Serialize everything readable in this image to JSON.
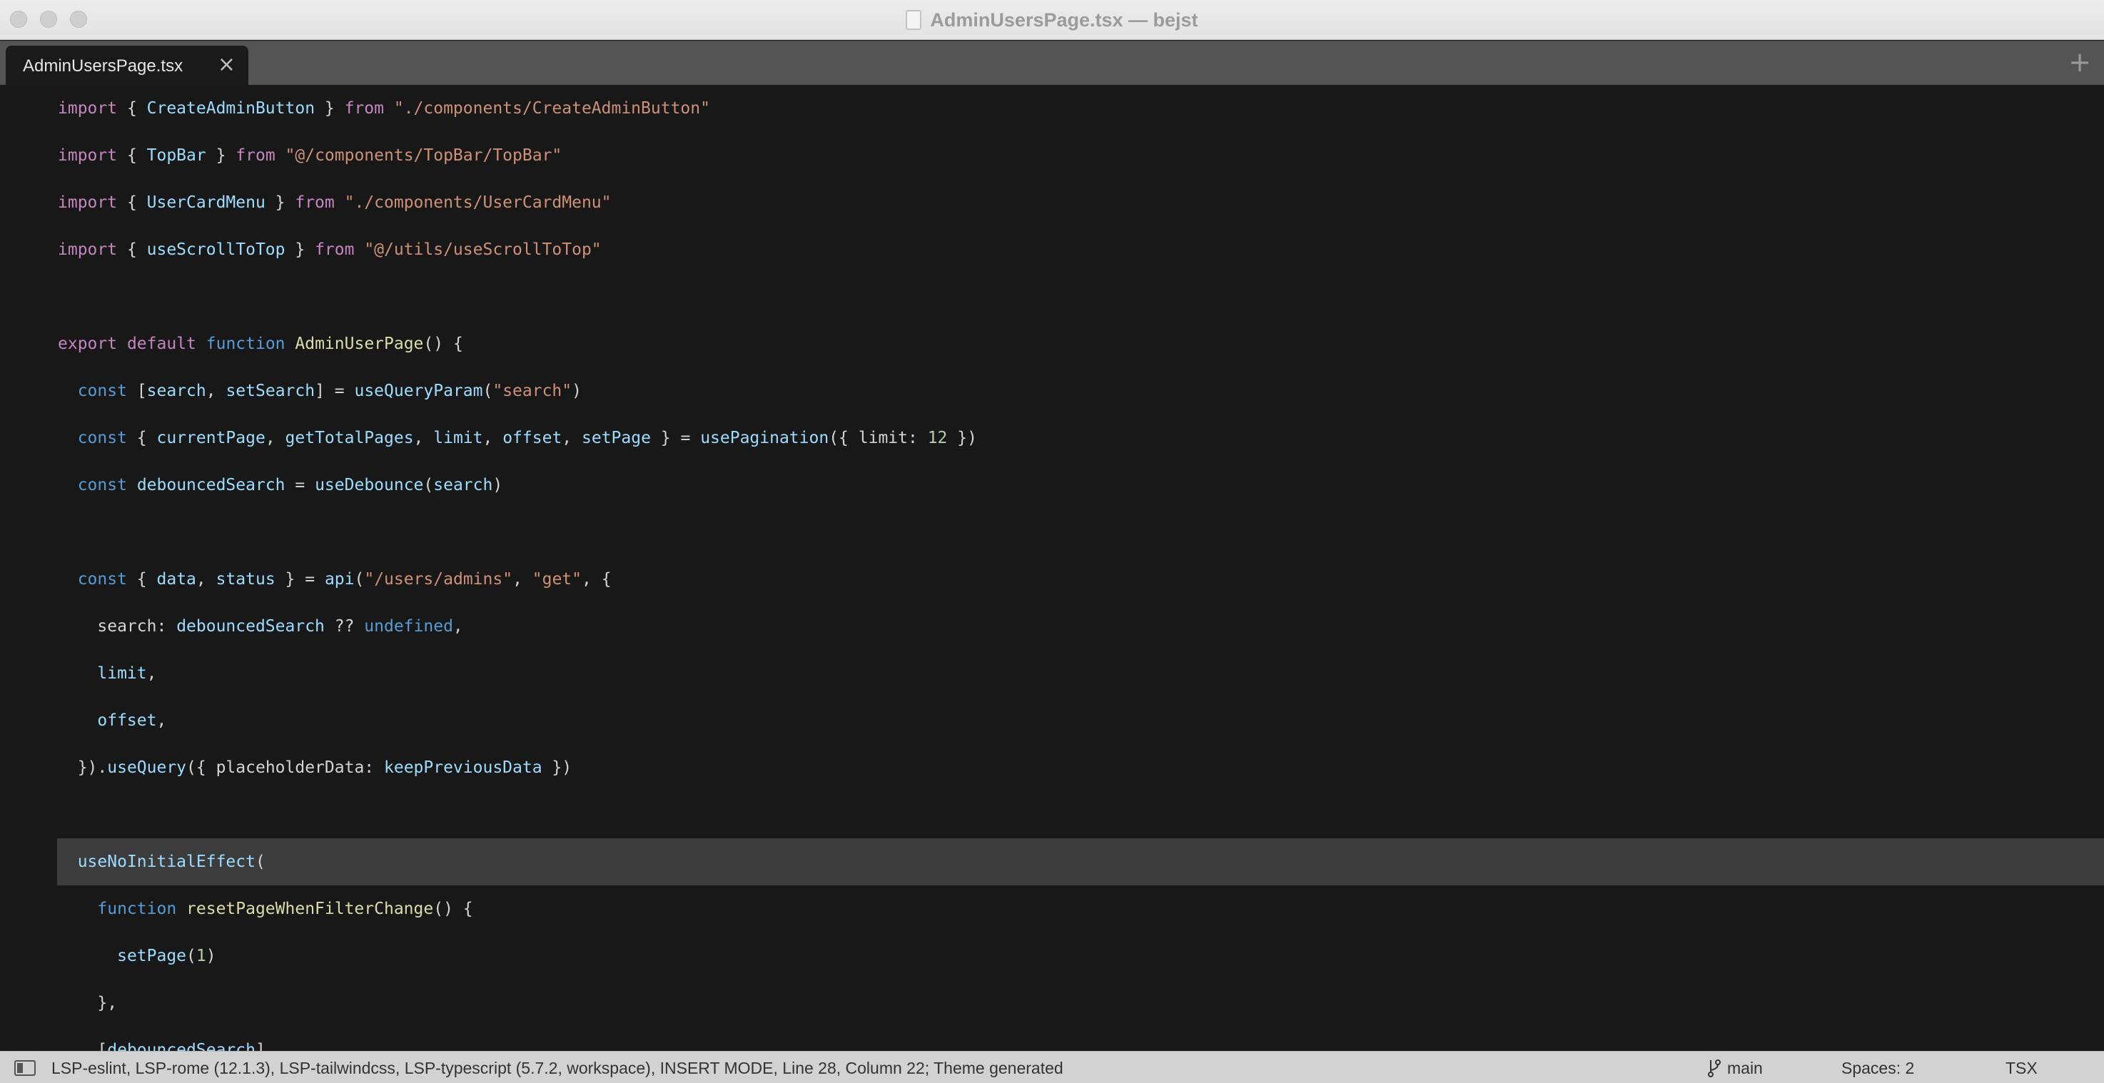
{
  "window": {
    "title": "AdminUsersPage.tsx — bejst",
    "traffic_lights": [
      "close",
      "minimize",
      "zoom"
    ]
  },
  "tabs": [
    {
      "label": "AdminUsersPage.tsx",
      "close_glyph": "×",
      "active": true
    }
  ],
  "tabbar": {
    "add_glyph": "+"
  },
  "editor": {
    "current_line_index": 16,
    "lines": [
      [
        [
          "t-kw",
          "import"
        ],
        [
          "t-pun",
          " { "
        ],
        [
          "t-id",
          "CreateAdminButton"
        ],
        [
          "t-pun",
          " } "
        ],
        [
          "t-kw",
          "from"
        ],
        [
          "t-pun",
          " "
        ],
        [
          "t-str",
          "\"./components/CreateAdminButton\""
        ]
      ],
      [
        [
          "t-kw",
          "import"
        ],
        [
          "t-pun",
          " { "
        ],
        [
          "t-id",
          "TopBar"
        ],
        [
          "t-pun",
          " } "
        ],
        [
          "t-kw",
          "from"
        ],
        [
          "t-pun",
          " "
        ],
        [
          "t-str",
          "\"@/components/TopBar/TopBar\""
        ]
      ],
      [
        [
          "t-kw",
          "import"
        ],
        [
          "t-pun",
          " { "
        ],
        [
          "t-id",
          "UserCardMenu"
        ],
        [
          "t-pun",
          " } "
        ],
        [
          "t-kw",
          "from"
        ],
        [
          "t-pun",
          " "
        ],
        [
          "t-str",
          "\"./components/UserCardMenu\""
        ]
      ],
      [
        [
          "t-kw",
          "import"
        ],
        [
          "t-pun",
          " { "
        ],
        [
          "t-id",
          "useScrollToTop"
        ],
        [
          "t-pun",
          " } "
        ],
        [
          "t-kw",
          "from"
        ],
        [
          "t-pun",
          " "
        ],
        [
          "t-str",
          "\"@/utils/useScrollToTop\""
        ]
      ],
      [],
      [
        [
          "t-kw",
          "export"
        ],
        [
          "t-pun",
          " "
        ],
        [
          "t-kw",
          "default"
        ],
        [
          "t-pun",
          " "
        ],
        [
          "t-kw2",
          "function"
        ],
        [
          "t-pun",
          " "
        ],
        [
          "t-fn",
          "AdminUserPage"
        ],
        [
          "t-pun",
          "() {"
        ]
      ],
      [
        [
          "t-pun",
          "  "
        ],
        [
          "t-kw2",
          "const"
        ],
        [
          "t-pun",
          " ["
        ],
        [
          "t-id",
          "search"
        ],
        [
          "t-pun",
          ", "
        ],
        [
          "t-id",
          "setSearch"
        ],
        [
          "t-pun",
          "] = "
        ],
        [
          "t-fnb",
          "useQueryParam"
        ],
        [
          "t-pun",
          "("
        ],
        [
          "t-str",
          "\"search\""
        ],
        [
          "t-pun",
          ")"
        ]
      ],
      [
        [
          "t-pun",
          "  "
        ],
        [
          "t-kw2",
          "const"
        ],
        [
          "t-pun",
          " { "
        ],
        [
          "t-id",
          "currentPage"
        ],
        [
          "t-pun",
          ", "
        ],
        [
          "t-id",
          "getTotalPages"
        ],
        [
          "t-pun",
          ", "
        ],
        [
          "t-id",
          "limit"
        ],
        [
          "t-pun",
          ", "
        ],
        [
          "t-id",
          "offset"
        ],
        [
          "t-pun",
          ", "
        ],
        [
          "t-id",
          "setPage"
        ],
        [
          "t-pun",
          " } = "
        ],
        [
          "t-fnb",
          "usePagination"
        ],
        [
          "t-pun",
          "({ "
        ],
        [
          "t-prop",
          "limit"
        ],
        [
          "t-pun",
          ": "
        ],
        [
          "t-num",
          "12"
        ],
        [
          "t-pun",
          " })"
        ]
      ],
      [
        [
          "t-pun",
          "  "
        ],
        [
          "t-kw2",
          "const"
        ],
        [
          "t-pun",
          " "
        ],
        [
          "t-id",
          "debouncedSearch"
        ],
        [
          "t-pun",
          " = "
        ],
        [
          "t-fnb",
          "useDebounce"
        ],
        [
          "t-pun",
          "("
        ],
        [
          "t-id",
          "search"
        ],
        [
          "t-pun",
          ")"
        ]
      ],
      [],
      [
        [
          "t-pun",
          "  "
        ],
        [
          "t-kw2",
          "const"
        ],
        [
          "t-pun",
          " { "
        ],
        [
          "t-id",
          "data"
        ],
        [
          "t-pun",
          ", "
        ],
        [
          "t-id",
          "status"
        ],
        [
          "t-pun",
          " } = "
        ],
        [
          "t-fnb",
          "api"
        ],
        [
          "t-pun",
          "("
        ],
        [
          "t-str",
          "\"/users/admins\""
        ],
        [
          "t-pun",
          ", "
        ],
        [
          "t-str",
          "\"get\""
        ],
        [
          "t-pun",
          ", {"
        ]
      ],
      [
        [
          "t-pun",
          "    "
        ],
        [
          "t-prop",
          "search"
        ],
        [
          "t-pun",
          ": "
        ],
        [
          "t-id",
          "debouncedSearch"
        ],
        [
          "t-pun",
          " ?? "
        ],
        [
          "t-kw2",
          "undefined"
        ],
        [
          "t-pun",
          ","
        ]
      ],
      [
        [
          "t-pun",
          "    "
        ],
        [
          "t-id",
          "limit"
        ],
        [
          "t-pun",
          ","
        ]
      ],
      [
        [
          "t-pun",
          "    "
        ],
        [
          "t-id",
          "offset"
        ],
        [
          "t-pun",
          ","
        ]
      ],
      [
        [
          "t-pun",
          "  })."
        ],
        [
          "t-fnb",
          "useQuery"
        ],
        [
          "t-pun",
          "({ "
        ],
        [
          "t-prop",
          "placeholderData"
        ],
        [
          "t-pun",
          ": "
        ],
        [
          "t-id",
          "keepPreviousData"
        ],
        [
          "t-pun",
          " })"
        ]
      ],
      [],
      [
        [
          "t-pun",
          "  "
        ],
        [
          "t-fnb",
          "useNoInitialEffect"
        ],
        [
          "t-pun",
          "("
        ]
      ],
      [
        [
          "t-pun",
          "    "
        ],
        [
          "t-kw2",
          "function"
        ],
        [
          "t-pun",
          " "
        ],
        [
          "t-fn",
          "resetPageWhenFilterChange"
        ],
        [
          "t-pun",
          "() {"
        ]
      ],
      [
        [
          "t-pun",
          "      "
        ],
        [
          "t-fnb",
          "setPage"
        ],
        [
          "t-pun",
          "("
        ],
        [
          "t-num",
          "1"
        ],
        [
          "t-pun",
          ")"
        ]
      ],
      [
        [
          "t-pun",
          "    },"
        ]
      ],
      [
        [
          "t-pun",
          "    ["
        ],
        [
          "t-id",
          "debouncedSearch"
        ],
        [
          "t-pun",
          "]"
        ]
      ]
    ]
  },
  "statusbar": {
    "sidebar_icon": "sidebar-toggle-icon",
    "info": "LSP-eslint, LSP-rome (12.1.3), LSP-tailwindcss, LSP-typescript (5.7.2, workspace), INSERT MODE, Line 28, Column 22; Theme generated",
    "branch_icon": "git-branch-icon",
    "branch": "main",
    "indentation": "Spaces: 2",
    "syntax": "TSX"
  }
}
